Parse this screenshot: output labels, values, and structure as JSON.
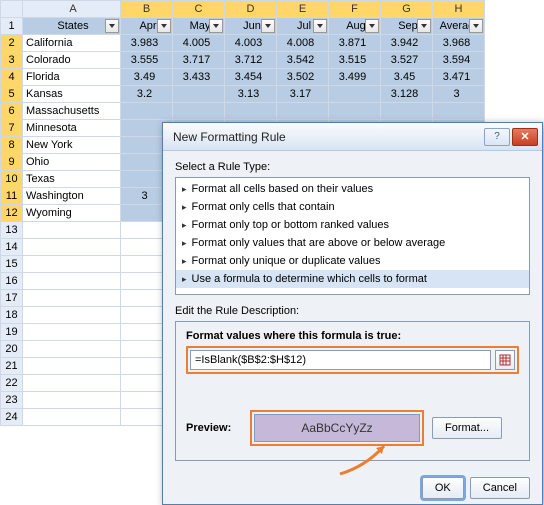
{
  "columns": {
    "corner": "",
    "A": "A",
    "B": "B",
    "C": "C",
    "D": "D",
    "E": "E",
    "F": "F",
    "G": "G",
    "H": "H"
  },
  "headers": {
    "states": "States",
    "apr": "Apr",
    "may": "May",
    "jun": "Jun",
    "jul": "Jul",
    "aug": "Aug",
    "sep": "Sep",
    "avg": "Average"
  },
  "rows": [
    {
      "n": "1"
    },
    {
      "n": "2",
      "state": "California",
      "apr": "3.983",
      "may": "4.005",
      "jun": "4.003",
      "jul": "4.008",
      "aug": "3.871",
      "sep": "3.942",
      "avg": "3.968"
    },
    {
      "n": "3",
      "state": "Colorado",
      "apr": "3.555",
      "may": "3.717",
      "jun": "3.712",
      "jul": "3.542",
      "aug": "3.515",
      "sep": "3.527",
      "avg": "3.594"
    },
    {
      "n": "4",
      "state": "Florida",
      "apr": "3.49",
      "may": "3.433",
      "jun": "3.454",
      "jul": "3.502",
      "aug": "3.499",
      "sep": "3.45",
      "avg": "3.471"
    },
    {
      "n": "5",
      "state": "Kansas",
      "apr": "3.2",
      "may": "",
      "jun": "3.13",
      "jul": "3.17",
      "aug": "",
      "sep": "3.128",
      "avg": "3"
    },
    {
      "n": "6",
      "state": "Massachusetts",
      "apr": "",
      "may": "",
      "jun": "",
      "jul": "",
      "aug": "",
      "sep": "",
      "avg": ""
    },
    {
      "n": "7",
      "state": "Minnesota",
      "apr": "",
      "may": "",
      "jun": "",
      "jul": "",
      "aug": "",
      "sep": "",
      "avg": ""
    },
    {
      "n": "8",
      "state": "New York",
      "apr": "",
      "may": "",
      "jun": "",
      "jul": "",
      "aug": "",
      "sep": "",
      "avg": ""
    },
    {
      "n": "9",
      "state": "Ohio",
      "apr": "",
      "may": "",
      "jun": "",
      "jul": "",
      "aug": "",
      "sep": "",
      "avg": ""
    },
    {
      "n": "10",
      "state": "Texas",
      "apr": "",
      "may": "",
      "jun": "",
      "jul": "",
      "aug": "",
      "sep": "",
      "avg": ""
    },
    {
      "n": "11",
      "state": "Washington",
      "apr": "3",
      "may": "",
      "jun": "",
      "jul": "",
      "aug": "",
      "sep": "",
      "avg": ""
    },
    {
      "n": "12",
      "state": "Wyoming",
      "apr": "",
      "may": "",
      "jun": "",
      "jul": "",
      "aug": "",
      "sep": "",
      "avg": ""
    }
  ],
  "emptyrows": [
    "13",
    "14",
    "15",
    "16",
    "17",
    "18",
    "19",
    "20",
    "21",
    "22",
    "23",
    "24"
  ],
  "dialog": {
    "title": "New Formatting Rule",
    "help": "?",
    "close": "✕",
    "select_label": "Select a Rule Type:",
    "rules": [
      "Format all cells based on their values",
      "Format only cells that contain",
      "Format only top or bottom ranked values",
      "Format only values that are above or below average",
      "Format only unique or duplicate values",
      "Use a formula to determine which cells to format"
    ],
    "edit_label": "Edit the Rule Description:",
    "formula_label": "Format values where this formula is true:",
    "formula_value": "=IsBlank($B$2:$H$12)",
    "preview_label": "Preview:",
    "preview_text": "AaBbCcYyZz",
    "format_btn": "Format...",
    "ok": "OK",
    "cancel": "Cancel"
  }
}
